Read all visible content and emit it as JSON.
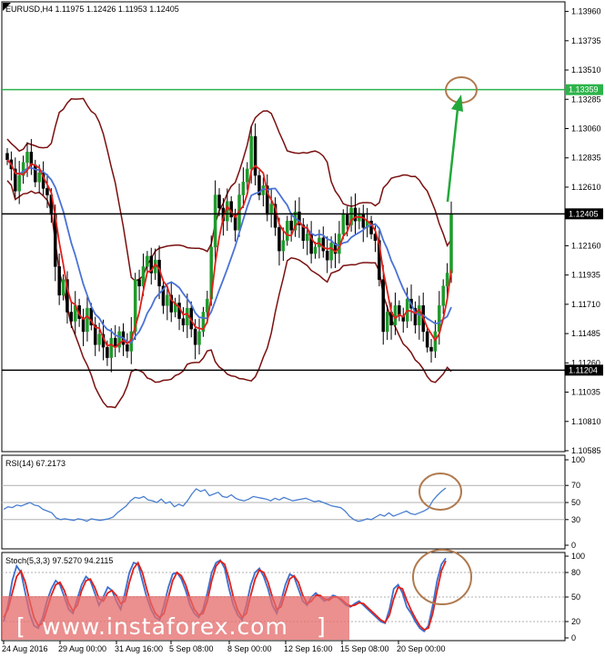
{
  "chart_data": {
    "type": "candlestick",
    "symbol_header": "EURUSD,H4  1.11975 1.12426 1.11953 1.12405",
    "y_ticks": [
      "1.13960",
      "1.13735",
      "1.13510",
      "1.13285",
      "1.13060",
      "1.12835",
      "1.12610",
      "1.12160",
      "1.11935",
      "1.11710",
      "1.11485",
      "1.11260",
      "1.11035",
      "1.10810",
      "1.10585"
    ],
    "y_tick_values": [
      1.1396,
      1.13735,
      1.1351,
      1.13285,
      1.1306,
      1.12835,
      1.1261,
      1.1216,
      1.11935,
      1.1171,
      1.11485,
      1.1126,
      1.11035,
      1.1081,
      1.10585
    ],
    "ylim": [
      1.10585,
      1.1402
    ],
    "x_ticks": [
      "24 Aug 2016",
      "29 Aug 00:00",
      "31 Aug 16:00",
      "5 Sep 08:00",
      "8 Sep 00:00",
      "12 Sep 16:00",
      "15 Sep 08:00",
      "20 Sep 00:00"
    ],
    "horizontal_levels": [
      {
        "value": 1.13359,
        "label": "1.13359",
        "color": "#2db34a"
      },
      {
        "value": 1.12405,
        "label": "1.12405",
        "color": "#000000"
      },
      {
        "value": 1.11204,
        "label": "1.11204",
        "color": "#000000"
      }
    ],
    "close_series": [
      1.1282,
      1.1275,
      1.1258,
      1.127,
      1.128,
      1.1288,
      1.1278,
      1.1265,
      1.1272,
      1.126,
      1.1255,
      1.124,
      1.12,
      1.1178,
      1.119,
      1.1165,
      1.1158,
      1.117,
      1.116,
      1.115,
      1.1168,
      1.1155,
      1.114,
      1.1148,
      1.1138,
      1.113,
      1.1145,
      1.1138,
      1.115,
      1.114,
      1.1135,
      1.115,
      1.119,
      1.1185,
      1.12,
      1.1208,
      1.1195,
      1.1205,
      1.1185,
      1.117,
      1.1178,
      1.1165,
      1.1172,
      1.116,
      1.1155,
      1.1168,
      1.1152,
      1.114,
      1.115,
      1.1165,
      1.1175,
      1.1215,
      1.1255,
      1.1245,
      1.1235,
      1.125,
      1.1238,
      1.1228,
      1.1255,
      1.1265,
      1.1275,
      1.13,
      1.127,
      1.1255,
      1.1262,
      1.124,
      1.1248,
      1.123,
      1.1212,
      1.122,
      1.1235,
      1.1228,
      1.1242,
      1.1232,
      1.122,
      1.1225,
      1.121,
      1.1215,
      1.1222,
      1.1212,
      1.1205,
      1.1218,
      1.121,
      1.1225,
      1.124,
      1.1232,
      1.1245,
      1.1235,
      1.124,
      1.123,
      1.1235,
      1.1225,
      1.122,
      1.119,
      1.115,
      1.1165,
      1.1155,
      1.117,
      1.1162,
      1.1158,
      1.1175,
      1.1168,
      1.1155,
      1.117,
      1.115,
      1.1138,
      1.1135,
      1.115,
      1.117,
      1.1185,
      1.1195,
      1.124
    ],
    "rsi": {
      "label": "RSI(14) 67.2173",
      "y_ticks": [
        "100",
        "70",
        "50",
        "30",
        "0"
      ],
      "y_tick_values": [
        100,
        70,
        50,
        30,
        0
      ],
      "levels": [
        70,
        50,
        30
      ],
      "values": [
        42,
        45,
        44,
        47,
        46,
        48,
        50,
        47,
        46,
        42,
        40,
        38,
        32,
        30,
        31,
        30,
        29,
        31,
        30,
        28,
        31,
        30,
        29,
        30,
        31,
        33,
        38,
        42,
        46,
        52,
        56,
        55,
        57,
        53,
        52,
        50,
        54,
        49,
        51,
        45,
        48,
        46,
        52,
        60,
        66,
        63,
        65,
        58,
        60,
        62,
        57,
        56,
        59,
        55,
        53,
        52,
        54,
        57,
        56,
        55,
        54,
        52,
        55,
        53,
        56,
        54,
        52,
        53,
        54,
        55,
        53,
        51,
        52,
        50,
        48,
        46,
        45,
        44,
        40,
        34,
        30,
        28,
        29,
        31,
        30,
        33,
        36,
        34,
        38,
        34,
        36,
        38,
        40,
        37,
        36,
        38,
        40,
        43,
        52,
        58,
        63,
        67
      ]
    },
    "stoch": {
      "label": "Stoch(5,3,3) 97.5270 94.2115",
      "y_ticks": [
        "100",
        "80",
        "50",
        "20",
        "0"
      ],
      "y_tick_values": [
        100,
        80,
        50,
        20,
        0
      ],
      "levels": [
        80,
        50,
        20
      ],
      "main": [
        20,
        40,
        70,
        88,
        80,
        55,
        30,
        15,
        12,
        25,
        45,
        60,
        70,
        65,
        50,
        35,
        30,
        48,
        65,
        75,
        70,
        55,
        40,
        50,
        62,
        58,
        45,
        35,
        55,
        80,
        92,
        90,
        70,
        50,
        35,
        25,
        22,
        40,
        62,
        78,
        80,
        72,
        58,
        40,
        30,
        25,
        35,
        55,
        80,
        92,
        95,
        85,
        60,
        40,
        28,
        22,
        40,
        65,
        80,
        85,
        75,
        60,
        40,
        30,
        45,
        65,
        78,
        75,
        60,
        45,
        40,
        50,
        55,
        50,
        45,
        48,
        52,
        50,
        45,
        40,
        38,
        42,
        45,
        40,
        35,
        30,
        25,
        20,
        18,
        35,
        60,
        65,
        55,
        38,
        30,
        20,
        12,
        8,
        15,
        40,
        70,
        90,
        97.5
      ],
      "signal": [
        25,
        35,
        55,
        75,
        82,
        68,
        45,
        25,
        15,
        18,
        35,
        52,
        65,
        68,
        58,
        42,
        33,
        40,
        58,
        70,
        72,
        62,
        48,
        45,
        55,
        58,
        52,
        42,
        45,
        68,
        85,
        92,
        80,
        60,
        42,
        30,
        25,
        30,
        50,
        70,
        80,
        76,
        65,
        48,
        35,
        28,
        30,
        45,
        70,
        88,
        94,
        90,
        72,
        50,
        34,
        25,
        30,
        52,
        72,
        83,
        80,
        68,
        50,
        35,
        38,
        55,
        72,
        76,
        68,
        52,
        42,
        45,
        52,
        52,
        48,
        46,
        50,
        50,
        47,
        42,
        39,
        40,
        43,
        42,
        37,
        32,
        27,
        22,
        19,
        28,
        48,
        62,
        60,
        46,
        34,
        24,
        15,
        10,
        12,
        30,
        58,
        82,
        94.2
      ]
    },
    "watermark": "www.instaforex.com"
  }
}
